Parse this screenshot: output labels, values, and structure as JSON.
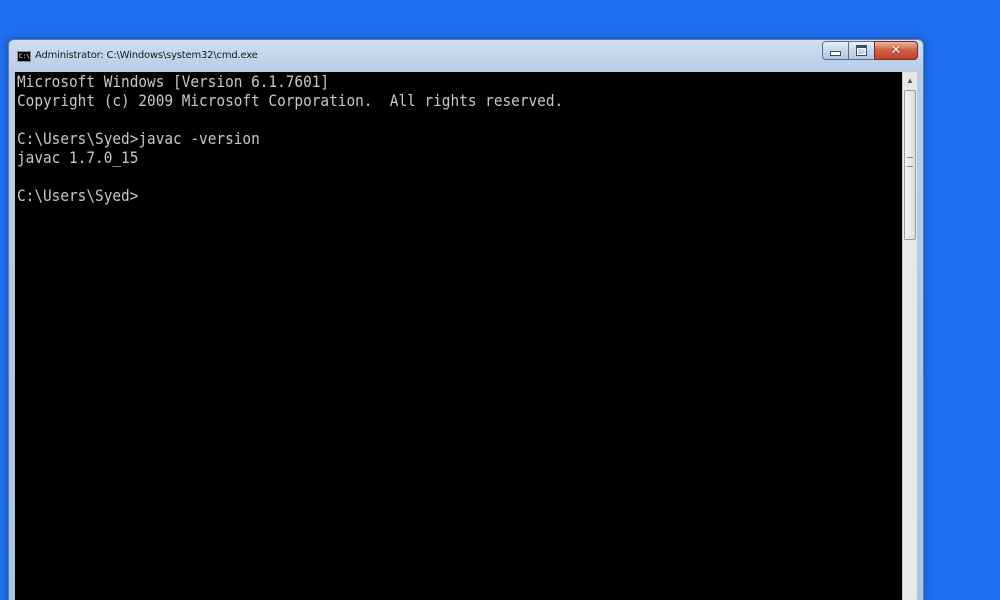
{
  "window": {
    "title": "Administrator: C:\\Windows\\system32\\cmd.exe",
    "icon": "cmd-icon",
    "controls": {
      "minimize_icon": "minimize-icon",
      "maximize_icon": "maximize-icon",
      "close_icon": "close-icon",
      "close_glyph": "✕"
    }
  },
  "console": {
    "lines": [
      "Microsoft Windows [Version 6.1.7601]",
      "Copyright (c) 2009 Microsoft Corporation.  All rights reserved.",
      "",
      "C:\\Users\\Syed>javac -version",
      "javac 1.7.0_15",
      "",
      "C:\\Users\\Syed>"
    ]
  },
  "colors": {
    "desktop": "#1f6ff0",
    "console_background": "#000000",
    "console_text": "#c8c8c8",
    "close_button": "#c2412a"
  }
}
